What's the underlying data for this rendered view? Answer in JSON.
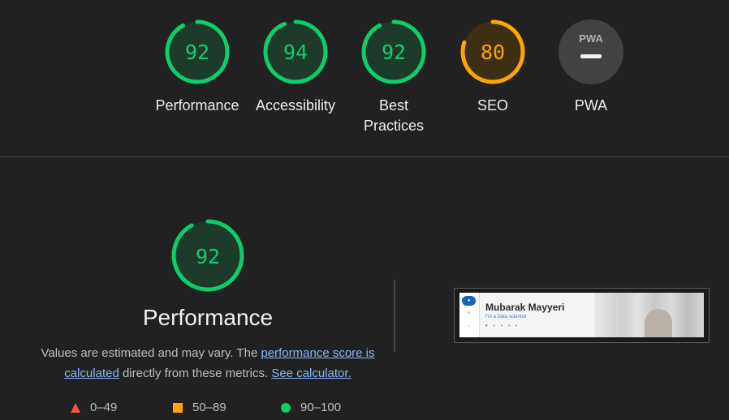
{
  "categories": [
    {
      "score": "92",
      "label": "Performance",
      "fraction": 0.92,
      "color": "#0cce6b"
    },
    {
      "score": "94",
      "label": "Accessibility",
      "fraction": 0.94,
      "color": "#0cce6b"
    },
    {
      "score": "92",
      "label": "Best Practices",
      "fraction": 0.92,
      "color": "#0cce6b"
    },
    {
      "score": "80",
      "label": "SEO",
      "fraction": 0.8,
      "color": "#ffa400"
    },
    {
      "badge": "PWA",
      "label": "PWA"
    }
  ],
  "performance": {
    "score": "92",
    "fraction": 0.92,
    "title": "Performance",
    "desc_prefix": "Values are estimated and may vary. The ",
    "link_score": "performance score is calculated",
    "desc_mid": " directly from these metrics. ",
    "link_calc": "See calculator."
  },
  "legend": [
    {
      "range": "0–49",
      "shape": "triangle",
      "color": "#ff4e42"
    },
    {
      "range": "50–89",
      "shape": "square",
      "color": "#ffa400"
    },
    {
      "range": "90–100",
      "shape": "circle",
      "color": "#0cce6b"
    }
  ],
  "screenshot": {
    "name": "Mubarak Mayyeri",
    "subtitle": "I'm a Data scientist"
  }
}
